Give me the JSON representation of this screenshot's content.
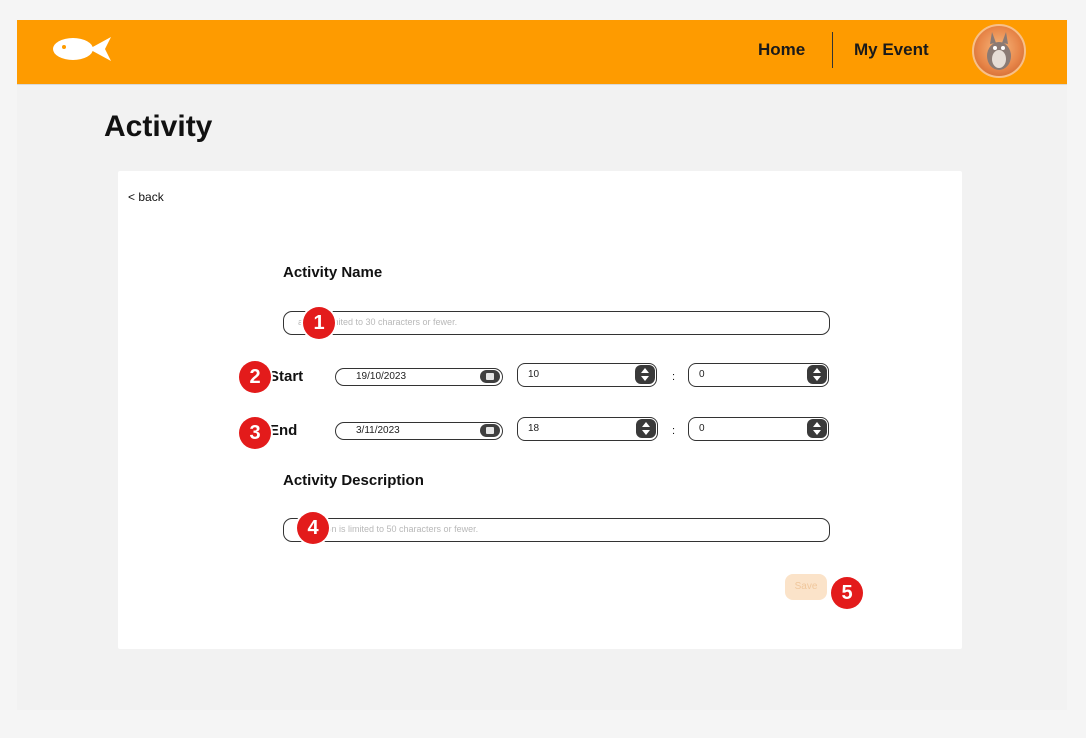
{
  "nav": {
    "home": "Home",
    "my_event": "My Event"
  },
  "page": {
    "title": "Activity"
  },
  "form": {
    "back": "< back",
    "name_label": "Activity Name",
    "name_placeholder": "Activity name is limited to 30 characters or fewer.",
    "name_visible_placeholder": "ame is limited to 30 characters or fewer.",
    "start_label": "Start",
    "start_date": "19/10/2023",
    "start_hour": "10",
    "start_minute": "0",
    "end_label": "End",
    "end_date": "3/11/2023",
    "end_hour": "18",
    "end_minute": "0",
    "time_separator": ":",
    "description_label": "Activity Description",
    "description_placeholder": "Description is limited to 50 characters or fewer.",
    "description_visible_placeholder": "escription is limited to 50 characters or fewer.",
    "save": "Save"
  },
  "annotations": [
    "1",
    "2",
    "3",
    "4",
    "5"
  ],
  "colors": {
    "header": "#fe9b00",
    "badge": "#e31b1b",
    "save_disabled_bg": "#fbe3c9"
  },
  "icons": [
    "fish-logo-icon",
    "calendar-icon",
    "spinner-arrows-icon",
    "user-avatar"
  ]
}
